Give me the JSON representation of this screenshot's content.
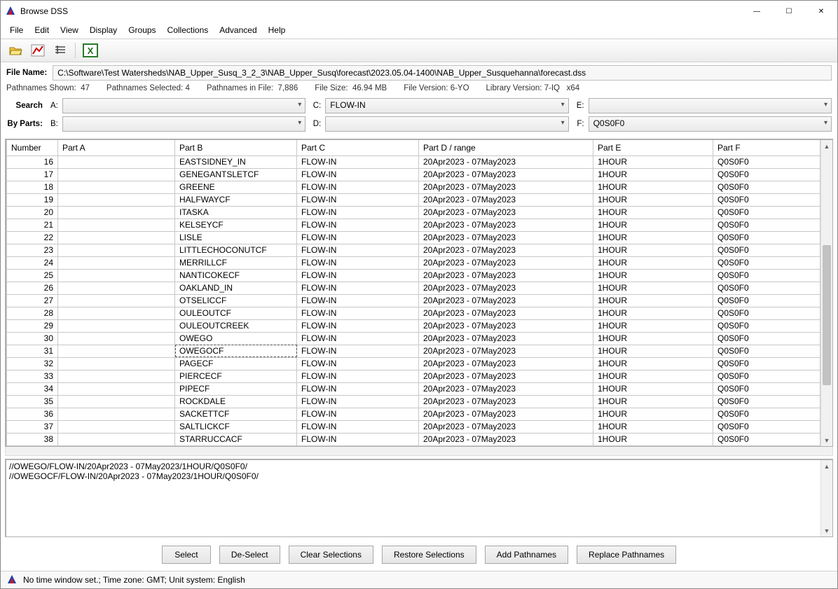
{
  "window": {
    "title": "Browse DSS"
  },
  "menu": [
    "File",
    "Edit",
    "View",
    "Display",
    "Groups",
    "Collections",
    "Advanced",
    "Help"
  ],
  "file": {
    "label": "File Name:",
    "path": "C:\\Software\\Test Watersheds\\NAB_Upper_Susq_3_2_3\\NAB_Upper_Susq\\forecast\\2023.05.04-1400\\NAB_Upper_Susquehanna\\forecast.dss"
  },
  "stats": {
    "shown_label": "Pathnames Shown:",
    "shown": "47",
    "selected_label": "Pathnames Selected:",
    "selected": "4",
    "infile_label": "Pathnames in File:",
    "infile": "7,886",
    "filesize_label": "File Size:",
    "filesize": "46.94  MB",
    "filever_label": "File Version:",
    "filever": "6-YO",
    "libver_label": "Library Version:",
    "libver": "7-IQ",
    "arch": "x64"
  },
  "filter": {
    "search_label": "Search",
    "byparts_label": "By Parts:",
    "A": "",
    "B": "",
    "C": "FLOW-IN",
    "D": "",
    "E": "",
    "F": "Q0S0F0"
  },
  "columns": [
    "Number",
    "Part A",
    "Part B",
    "Part C",
    "Part D / range",
    "Part E",
    "Part F"
  ],
  "rows": [
    {
      "n": "16",
      "a": "",
      "b": "EASTSIDNEY_IN",
      "c": "FLOW-IN",
      "d": "20Apr2023 - 07May2023",
      "e": "1HOUR",
      "f": "Q0S0F0"
    },
    {
      "n": "17",
      "a": "",
      "b": "GENEGANTSLETCF",
      "c": "FLOW-IN",
      "d": "20Apr2023 - 07May2023",
      "e": "1HOUR",
      "f": "Q0S0F0"
    },
    {
      "n": "18",
      "a": "",
      "b": "GREENE",
      "c": "FLOW-IN",
      "d": "20Apr2023 - 07May2023",
      "e": "1HOUR",
      "f": "Q0S0F0"
    },
    {
      "n": "19",
      "a": "",
      "b": "HALFWAYCF",
      "c": "FLOW-IN",
      "d": "20Apr2023 - 07May2023",
      "e": "1HOUR",
      "f": "Q0S0F0"
    },
    {
      "n": "20",
      "a": "",
      "b": "ITASKA",
      "c": "FLOW-IN",
      "d": "20Apr2023 - 07May2023",
      "e": "1HOUR",
      "f": "Q0S0F0"
    },
    {
      "n": "21",
      "a": "",
      "b": "KELSEYCF",
      "c": "FLOW-IN",
      "d": "20Apr2023 - 07May2023",
      "e": "1HOUR",
      "f": "Q0S0F0"
    },
    {
      "n": "22",
      "a": "",
      "b": "LISLE",
      "c": "FLOW-IN",
      "d": "20Apr2023 - 07May2023",
      "e": "1HOUR",
      "f": "Q0S0F0"
    },
    {
      "n": "23",
      "a": "",
      "b": "LITTLECHOCONUTCF",
      "c": "FLOW-IN",
      "d": "20Apr2023 - 07May2023",
      "e": "1HOUR",
      "f": "Q0S0F0"
    },
    {
      "n": "24",
      "a": "",
      "b": "MERRILLCF",
      "c": "FLOW-IN",
      "d": "20Apr2023 - 07May2023",
      "e": "1HOUR",
      "f": "Q0S0F0"
    },
    {
      "n": "25",
      "a": "",
      "b": "NANTICOKECF",
      "c": "FLOW-IN",
      "d": "20Apr2023 - 07May2023",
      "e": "1HOUR",
      "f": "Q0S0F0"
    },
    {
      "n": "26",
      "a": "",
      "b": "OAKLAND_IN",
      "c": "FLOW-IN",
      "d": "20Apr2023 - 07May2023",
      "e": "1HOUR",
      "f": "Q0S0F0"
    },
    {
      "n": "27",
      "a": "",
      "b": "OTSELICCF",
      "c": "FLOW-IN",
      "d": "20Apr2023 - 07May2023",
      "e": "1HOUR",
      "f": "Q0S0F0"
    },
    {
      "n": "28",
      "a": "",
      "b": "OULEOUTCF",
      "c": "FLOW-IN",
      "d": "20Apr2023 - 07May2023",
      "e": "1HOUR",
      "f": "Q0S0F0"
    },
    {
      "n": "29",
      "a": "",
      "b": "OULEOUTCREEK",
      "c": "FLOW-IN",
      "d": "20Apr2023 - 07May2023",
      "e": "1HOUR",
      "f": "Q0S0F0"
    },
    {
      "n": "30",
      "a": "",
      "b": "OWEGO",
      "c": "FLOW-IN",
      "d": "20Apr2023 - 07May2023",
      "e": "1HOUR",
      "f": "Q0S0F0"
    },
    {
      "n": "31",
      "a": "",
      "b": "OWEGOCF",
      "c": "FLOW-IN",
      "d": "20Apr2023 - 07May2023",
      "e": "1HOUR",
      "f": "Q0S0F0",
      "focus": true
    },
    {
      "n": "32",
      "a": "",
      "b": "PAGECF",
      "c": "FLOW-IN",
      "d": "20Apr2023 - 07May2023",
      "e": "1HOUR",
      "f": "Q0S0F0"
    },
    {
      "n": "33",
      "a": "",
      "b": "PIERCECF",
      "c": "FLOW-IN",
      "d": "20Apr2023 - 07May2023",
      "e": "1HOUR",
      "f": "Q0S0F0"
    },
    {
      "n": "34",
      "a": "",
      "b": "PIPECF",
      "c": "FLOW-IN",
      "d": "20Apr2023 - 07May2023",
      "e": "1HOUR",
      "f": "Q0S0F0"
    },
    {
      "n": "35",
      "a": "",
      "b": "ROCKDALE",
      "c": "FLOW-IN",
      "d": "20Apr2023 - 07May2023",
      "e": "1HOUR",
      "f": "Q0S0F0"
    },
    {
      "n": "36",
      "a": "",
      "b": "SACKETTCF",
      "c": "FLOW-IN",
      "d": "20Apr2023 - 07May2023",
      "e": "1HOUR",
      "f": "Q0S0F0"
    },
    {
      "n": "37",
      "a": "",
      "b": "SALTLICKCF",
      "c": "FLOW-IN",
      "d": "20Apr2023 - 07May2023",
      "e": "1HOUR",
      "f": "Q0S0F0"
    },
    {
      "n": "38",
      "a": "",
      "b": "STARRUCCACF",
      "c": "FLOW-IN",
      "d": "20Apr2023 - 07May2023",
      "e": "1HOUR",
      "f": "Q0S0F0"
    }
  ],
  "selected_paths": [
    "//OWEGO/FLOW-IN/20Apr2023 - 07May2023/1HOUR/Q0S0F0/",
    "//OWEGOCF/FLOW-IN/20Apr2023 - 07May2023/1HOUR/Q0S0F0/"
  ],
  "buttons": {
    "select": "Select",
    "deselect": "De-Select",
    "clear": "Clear Selections",
    "restore": "Restore Selections",
    "add": "Add Pathnames",
    "replace": "Replace Pathnames"
  },
  "status": "No time window set.;  Time zone: GMT;  Unit system: English"
}
